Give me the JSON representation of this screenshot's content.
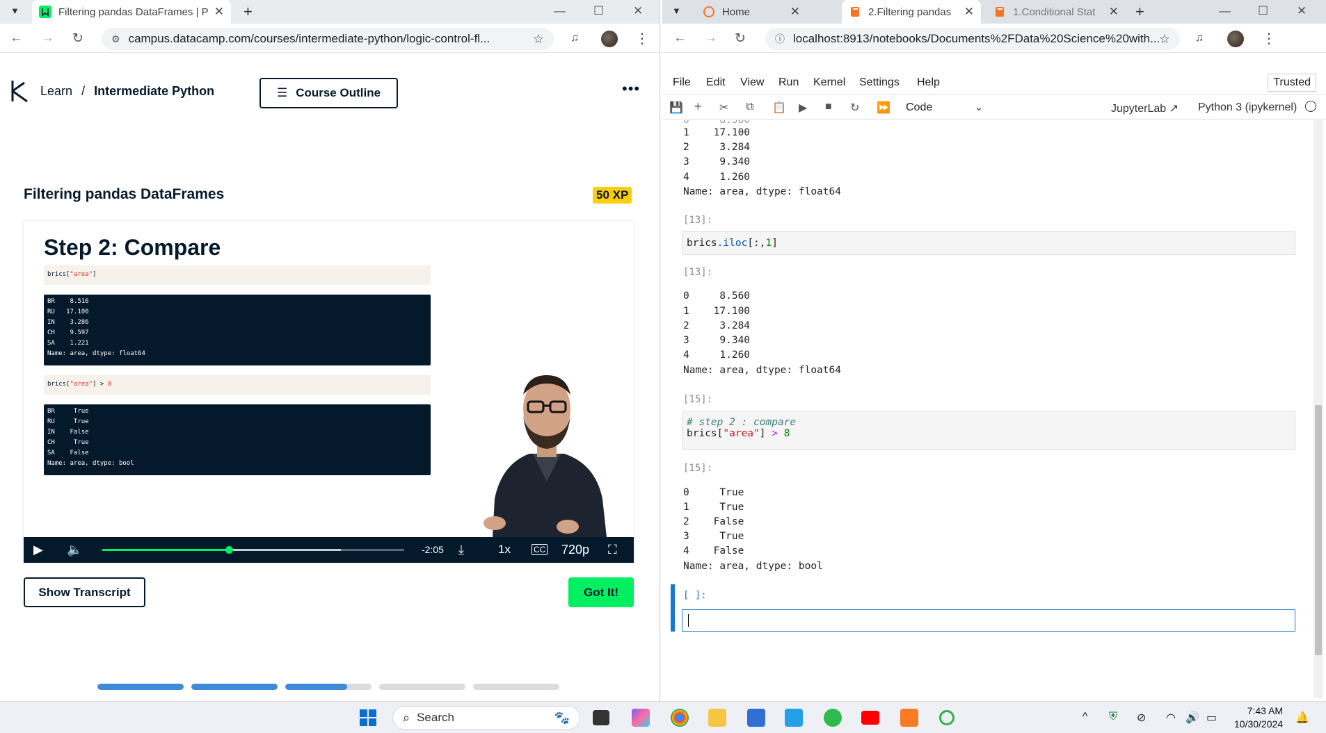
{
  "left_browser": {
    "tab_title": "Filtering pandas DataFrames | P",
    "url": "campus.datacamp.com/courses/intermediate-python/logic-control-fl..."
  },
  "right_browser": {
    "tabs": [
      {
        "title": "Home"
      },
      {
        "title": "2.Filtering pandas"
      },
      {
        "title": "1.Conditional Stat"
      }
    ],
    "url": "localhost:8913/notebooks/Documents%2FData%20Science%20with..."
  },
  "datacamp": {
    "breadcrumb_learn": "Learn",
    "breadcrumb_sep": "/",
    "breadcrumb_course": "Intermediate Python",
    "course_outline": "Course Outline",
    "exercise_title": "Filtering pandas DataFrames",
    "xp": "50 XP",
    "slide": {
      "title": "Step 2: Compare",
      "code1_pre": "brics[",
      "code1_str": "\"area\"",
      "code1_post": "]",
      "out1": [
        "BR    8.516",
        "RU   17.100",
        "IN    3.286",
        "CH    9.597",
        "SA    1.221",
        "Name: area, dtype: float64"
      ],
      "code2_pre": "brics[",
      "code2_str": "\"area\"",
      "code2_post": "] > ",
      "code2_num": "8",
      "out2": [
        "BR     True",
        "RU     True",
        "IN    False",
        "CH     True",
        "SA    False",
        "Name: area, dtype: bool"
      ]
    },
    "video": {
      "time_remaining": "-2:05",
      "speed": "1x",
      "quality": "720p",
      "progress": 0.42,
      "buffered": 0.79
    },
    "show_transcript": "Show Transcript",
    "got_it": "Got It!",
    "step_progress": [
      1.0,
      1.0,
      0.72,
      0,
      0
    ]
  },
  "jupyter": {
    "menu": [
      "File",
      "Edit",
      "View",
      "Run",
      "Kernel",
      "Settings",
      "Help"
    ],
    "trusted": "Trusted",
    "cell_type": "Code",
    "jupyterlab": "JupyterLab",
    "kernel": "Python 3 (ipykernel)",
    "out_top": [
      "1    17.100",
      "2     3.284",
      "3     9.340",
      "4     1.260",
      "Name: area, dtype: float64"
    ],
    "prompt13_in": "[13]:",
    "cell13_var": "brics",
    "cell13_fn": ".iloc",
    "cell13_rest": "[:,",
    "cell13_num": "1",
    "cell13_end": "]",
    "prompt13_out": "[13]:",
    "out13": [
      "0     8.560",
      "1    17.100",
      "2     3.284",
      "3     9.340",
      "4     1.260",
      "Name: area, dtype: float64"
    ],
    "prompt15_in": "[15]:",
    "cell15_comment": "# step 2 : compare",
    "cell15_var": "brics[",
    "cell15_str": "\"area\"",
    "cell15_close": "] ",
    "cell15_op": ">",
    "cell15_num": " 8",
    "prompt15_out": "[15]:",
    "out15": [
      "0     True",
      "1     True",
      "2    False",
      "3     True",
      "4    False",
      "Name: area, dtype: bool"
    ],
    "prompt_empty": "[ ]:"
  },
  "taskbar": {
    "search": "Search",
    "time": "7:43 AM",
    "date": "10/30/2024"
  }
}
